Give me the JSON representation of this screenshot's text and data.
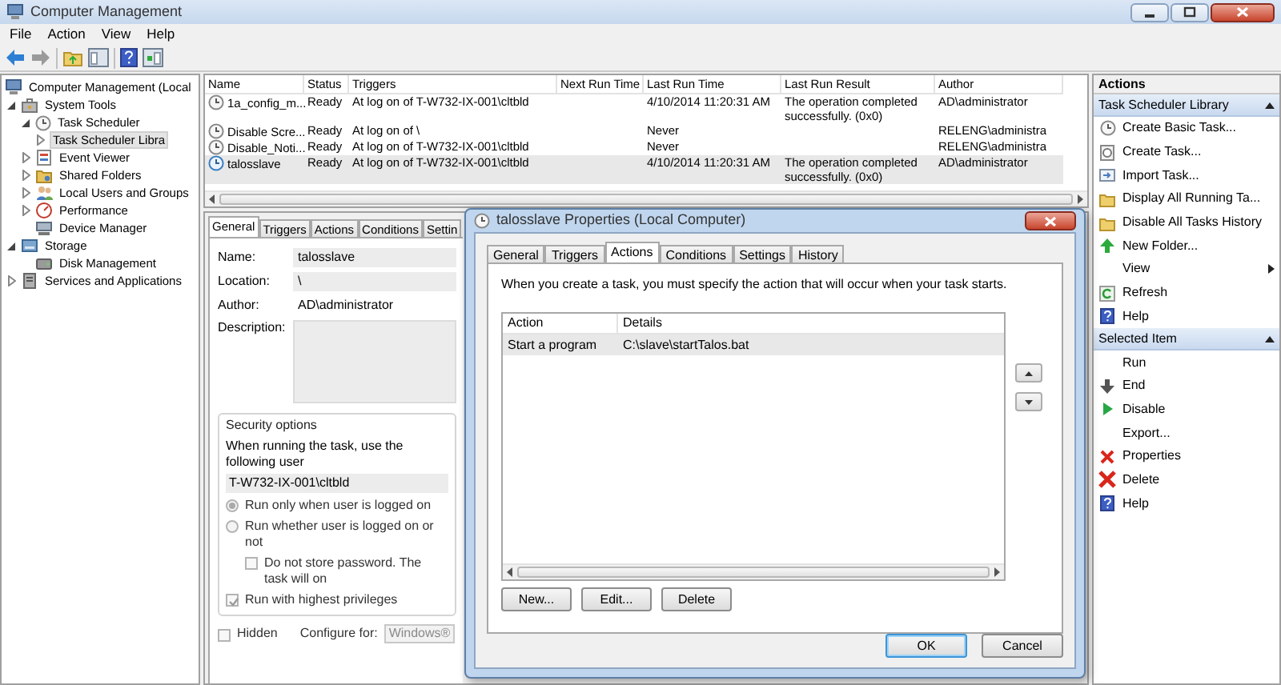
{
  "window": {
    "title": "Computer Management"
  },
  "menu": [
    "File",
    "Action",
    "View",
    "Help"
  ],
  "tree": [
    {
      "label": "Computer Management (Local",
      "selected": false,
      "children": [
        {
          "label": "System Tools",
          "expanded": true,
          "selected": false,
          "children": [
            {
              "label": "Task Scheduler",
              "expanded": true,
              "selected": false,
              "children": [
                {
                  "label": "Task Scheduler Libra",
                  "expanded": false,
                  "selected": true
                }
              ]
            },
            {
              "label": "Event Viewer",
              "expanded": false,
              "selected": false
            },
            {
              "label": "Shared Folders",
              "expanded": false,
              "selected": false
            },
            {
              "label": "Local Users and Groups",
              "expanded": false,
              "selected": false
            },
            {
              "label": "Performance",
              "expanded": false,
              "selected": false
            },
            {
              "label": "Device Manager",
              "selected": false
            }
          ]
        },
        {
          "label": "Storage",
          "expanded": true,
          "selected": false,
          "children": [
            {
              "label": "Disk Management",
              "selected": false
            }
          ]
        },
        {
          "label": "Services and Applications",
          "expanded": false,
          "selected": false
        }
      ]
    }
  ],
  "tasks": {
    "columns": [
      "Name",
      "Status",
      "Triggers",
      "Next Run Time",
      "Last Run Time",
      "Last Run Result",
      "Author"
    ],
    "rows": [
      {
        "cells": [
          "1a_config_m...",
          "Ready",
          "At log on of T-W732-IX-001\\cltbld",
          "",
          "4/10/2014 11:20:31 AM",
          "The operation completed successfully. (0x0)",
          "AD\\administrator"
        ],
        "selected": false
      },
      {
        "cells": [
          "Disable Scre...",
          "Ready",
          "At log on of \\",
          "",
          "Never",
          "",
          "RELENG\\administra"
        ],
        "selected": false
      },
      {
        "cells": [
          "Disable_Noti...",
          "Ready",
          "At log on of T-W732-IX-001\\cltbld",
          "",
          "Never",
          "",
          "RELENG\\administra"
        ],
        "selected": false
      },
      {
        "cells": [
          "talosslave",
          "Ready",
          "At log on of T-W732-IX-001\\cltbld",
          "",
          "4/10/2014 11:20:31 AM",
          "The operation completed successfully. (0x0)",
          "AD\\administrator"
        ],
        "selected": true
      }
    ]
  },
  "detail": {
    "tabs": [
      {
        "label": "General",
        "selected": true
      },
      {
        "label": "Triggers",
        "selected": false
      },
      {
        "label": "Actions",
        "selected": false
      },
      {
        "label": "Conditions",
        "selected": false
      },
      {
        "label": "Settin",
        "selected": false
      }
    ],
    "name_label": "Name:",
    "name": "talosslave",
    "location_label": "Location:",
    "location": "\\",
    "author_label": "Author:",
    "author": "AD\\administrator",
    "description_label": "Description:",
    "security_title": "Security options",
    "security_text": "When running the task, use the following user",
    "user": "T-W732-IX-001\\cltbld",
    "radios": [
      {
        "label": "Run only when user is logged on",
        "selected": true
      },
      {
        "label": "Run whether user is logged on or not",
        "selected": false
      }
    ],
    "no_password": {
      "label": "Do not store password.  The task will on",
      "checked": false
    },
    "highest": {
      "label": "Run with highest privileges",
      "checked": true
    },
    "hidden": {
      "label": "Hidden",
      "checked": false
    },
    "configure_label": "Configure for:",
    "configure_value": "Windows®"
  },
  "dialog": {
    "title": "talosslave Properties (Local Computer)",
    "tabs": [
      {
        "label": "General",
        "selected": false
      },
      {
        "label": "Triggers",
        "selected": false
      },
      {
        "label": "Actions",
        "selected": true
      },
      {
        "label": "Conditions",
        "selected": false
      },
      {
        "label": "Settings",
        "selected": false
      },
      {
        "label": "History",
        "selected": false
      }
    ],
    "intro": "When you create a task, you must specify the action that will occur when your task starts.",
    "columns": [
      "Action",
      "Details"
    ],
    "rows": [
      {
        "cells": [
          "Start a program",
          "C:\\slave\\startTalos.bat"
        ],
        "selected": true
      }
    ],
    "list_buttons": [
      "New...",
      "Edit...",
      "Delete"
    ],
    "buttons": [
      {
        "label": "OK",
        "default": true
      },
      {
        "label": "Cancel",
        "default": false
      }
    ]
  },
  "actions": {
    "title": "Actions",
    "sections": [
      {
        "title": "Task Scheduler Library",
        "expanded": true,
        "items": [
          {
            "label": "Create Basic Task...",
            "submenu": false
          },
          {
            "label": "Create Task...",
            "submenu": false
          },
          {
            "label": "Import Task...",
            "submenu": false
          },
          {
            "label": "Display All Running Ta...",
            "submenu": false
          },
          {
            "label": "Disable All Tasks History",
            "submenu": false
          },
          {
            "label": "New Folder...",
            "submenu": false
          },
          {
            "label": "View",
            "submenu": true
          },
          {
            "label": "Refresh",
            "submenu": false
          },
          {
            "label": "Help",
            "submenu": false
          }
        ]
      },
      {
        "title": "Selected Item",
        "expanded": true,
        "items": [
          {
            "label": "Run",
            "submenu": false
          },
          {
            "label": "End",
            "submenu": false
          },
          {
            "label": "Disable",
            "submenu": false
          },
          {
            "label": "Export...",
            "submenu": false
          },
          {
            "label": "Properties",
            "submenu": false
          },
          {
            "label": "Delete",
            "submenu": false
          },
          {
            "label": "Help",
            "submenu": false
          }
        ]
      }
    ]
  }
}
